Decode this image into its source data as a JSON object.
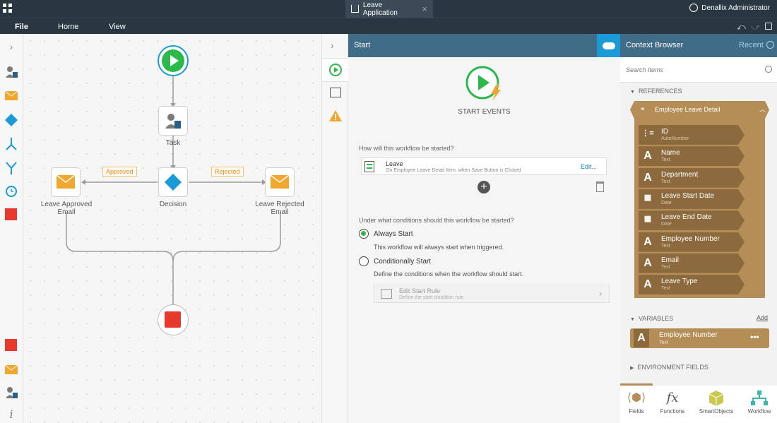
{
  "header": {
    "tab_title": "Leave Application",
    "user": "Denallix Administrator"
  },
  "menu": [
    "File",
    "Home",
    "View"
  ],
  "canvas": {
    "nodes": {
      "task": "Task",
      "decision": "Decision",
      "approved_email": "Leave Approved Email",
      "rejected_email": "Leave Rejected Email"
    },
    "tags": {
      "approved": "Approved",
      "rejected": "Rejected"
    }
  },
  "start_panel": {
    "title": "Start",
    "events_label": "START EVENTS",
    "question1": "How will this workflow be started?",
    "event_name": "Leave",
    "event_desc": "On Employee Leave Detail Item, when Save Button is Clicked",
    "edit_link": "Edit...",
    "question2": "Under what conditions should this workflow be started?",
    "always_label": "Always Start",
    "always_desc": "This workflow will always start when triggered.",
    "cond_label": "Conditionally Start",
    "cond_desc": "Define the conditions when the workflow should start.",
    "rule_title": "Edit Start Rule",
    "rule_desc": "Define the start condition rule."
  },
  "context": {
    "title": "Context Browser",
    "recent": "Recent",
    "search_placeholder": "Search Items",
    "references": "REFERENCES",
    "ref_group": "Employee Leave Detail",
    "fields": [
      {
        "name": "ID",
        "type": "AutoNumber",
        "icon": "autonumber-icon"
      },
      {
        "name": "Name",
        "type": "Text",
        "icon": "text-icon"
      },
      {
        "name": "Department",
        "type": "Text",
        "icon": "text-icon"
      },
      {
        "name": "Leave Start Date",
        "type": "Date",
        "icon": "calendar-icon"
      },
      {
        "name": "Leave End Date",
        "type": "Date",
        "icon": "calendar-icon"
      },
      {
        "name": "Employee Number",
        "type": "Text",
        "icon": "text-icon"
      },
      {
        "name": "Email",
        "type": "Text",
        "icon": "text-icon"
      },
      {
        "name": "Leave Type",
        "type": "Text",
        "icon": "text-icon"
      }
    ],
    "variables": "VARIABLES",
    "add": "Add",
    "var_name": "Employee Number",
    "var_type": "Text",
    "env": "ENVIRONMENT FIELDS",
    "bottom_tabs": [
      "Fields",
      "Functions",
      "SmartObjects",
      "Workflow"
    ]
  },
  "colors": {
    "header": "#293742",
    "panel_header": "#416c87",
    "accent_blue": "#1a9bd7",
    "green": "#2db84c",
    "red": "#e8392e",
    "orange": "#f1a62d",
    "brown": "#8c6a3e"
  }
}
